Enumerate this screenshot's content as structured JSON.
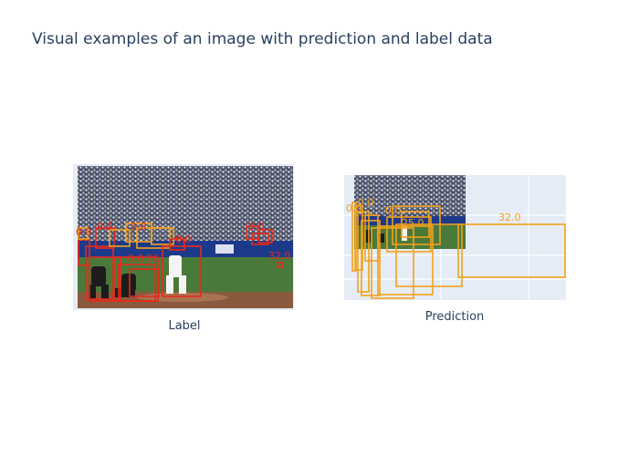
{
  "figure": {
    "title": "Visual examples of an image with prediction and label data"
  },
  "panels": [
    {
      "caption": "Label"
    },
    {
      "caption": "Prediction"
    }
  ],
  "colors": {
    "label_box": "#e8291c",
    "label_box_alt": "#f3a21b",
    "prediction_box": "#f4a11b",
    "plot_bg": "#e5ecf6",
    "grid": "#ffffff"
  },
  "chart_data": [
    {
      "type": "image_with_boxes",
      "panel": "Label",
      "labels": [
        "0.0",
        "0.0",
        "0.0",
        "0.0",
        "0.0",
        "32.0",
        "0.0",
        "36"
      ]
    },
    {
      "type": "image_with_boxes",
      "panel": "Prediction",
      "labels": [
        "0.0",
        "0.0",
        "0.0",
        "25.0",
        "32.0"
      ]
    }
  ]
}
